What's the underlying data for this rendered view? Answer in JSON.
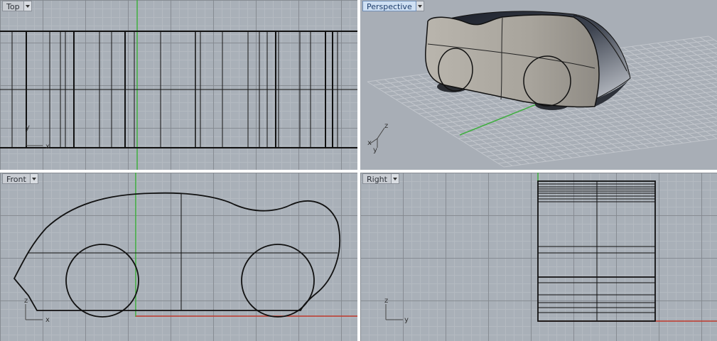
{
  "viewports": {
    "top": {
      "title": "Top"
    },
    "perspective": {
      "title": "Perspective"
    },
    "front": {
      "title": "Front"
    },
    "right": {
      "title": "Right"
    }
  },
  "axes": {
    "top": {
      "a": "y",
      "b": "x"
    },
    "perspective": {
      "a": "z",
      "b": "x",
      "c": "y"
    },
    "front": {
      "a": "z",
      "b": "x"
    },
    "right": {
      "a": "z",
      "b": "y"
    }
  },
  "colors": {
    "viewport_bg": "#a9b0b8",
    "x_axis": "#c0392b",
    "y_axis": "#3fae3f",
    "curve": "#111111",
    "active_title_bg": "#cfe0f3"
  },
  "icons": {
    "viewport_menu": "chevron-down-icon"
  }
}
